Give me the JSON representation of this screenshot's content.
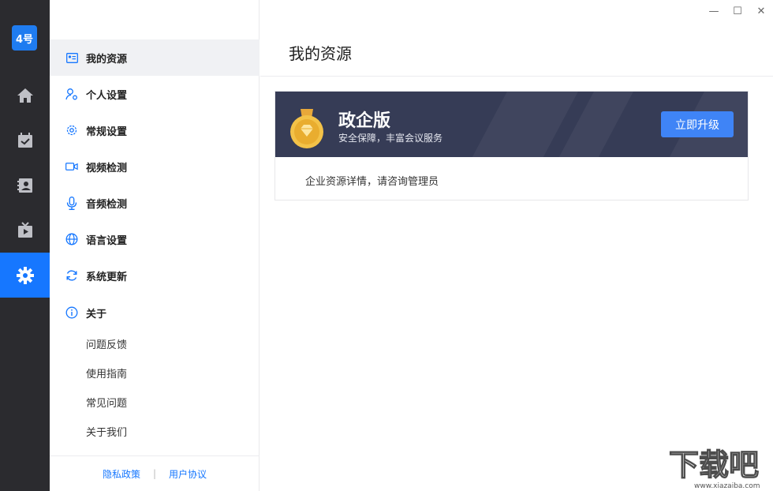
{
  "app": {
    "logo_text": "4号"
  },
  "rail": {
    "items": [
      {
        "name": "home",
        "icon": "home-icon"
      },
      {
        "name": "calendar",
        "icon": "calendar-check-icon"
      },
      {
        "name": "contacts",
        "icon": "contact-book-icon"
      },
      {
        "name": "live",
        "icon": "tv-play-icon"
      },
      {
        "name": "settings",
        "icon": "gear-icon",
        "active": true
      }
    ]
  },
  "window_controls": {
    "minimize": "—",
    "maximize": "☐",
    "close": "✕"
  },
  "menu": {
    "items": [
      {
        "label": "我的资源",
        "icon": "id-card-icon",
        "active": true
      },
      {
        "label": "个人设置",
        "icon": "user-settings-icon"
      },
      {
        "label": "常规设置",
        "icon": "gear-outline-icon"
      },
      {
        "label": "视频检测",
        "icon": "video-camera-icon"
      },
      {
        "label": "音频检测",
        "icon": "microphone-icon"
      },
      {
        "label": "语言设置",
        "icon": "globe-icon"
      },
      {
        "label": "系统更新",
        "icon": "refresh-icon"
      },
      {
        "label": "关于",
        "icon": "info-icon"
      }
    ],
    "sub_items": [
      "问题反馈",
      "使用指南",
      "常见问题",
      "关于我们"
    ],
    "footer": {
      "privacy": "隐私政策",
      "separator": "|",
      "agreement": "用户协议"
    }
  },
  "main": {
    "title": "我的资源",
    "edition": {
      "name": "政企版",
      "tagline": "安全保障，丰富会议服务",
      "upgrade_label": "立即升级",
      "info": "企业资源详情，请咨询管理员"
    }
  },
  "watermark": {
    "text": "下载吧",
    "url_text": "www.xiazaiba.com"
  },
  "colors": {
    "accent": "#1677ff",
    "rail_bg": "#2b2b2f",
    "banner_bg": "#363c56",
    "upgrade_bg": "#3f84f6"
  }
}
